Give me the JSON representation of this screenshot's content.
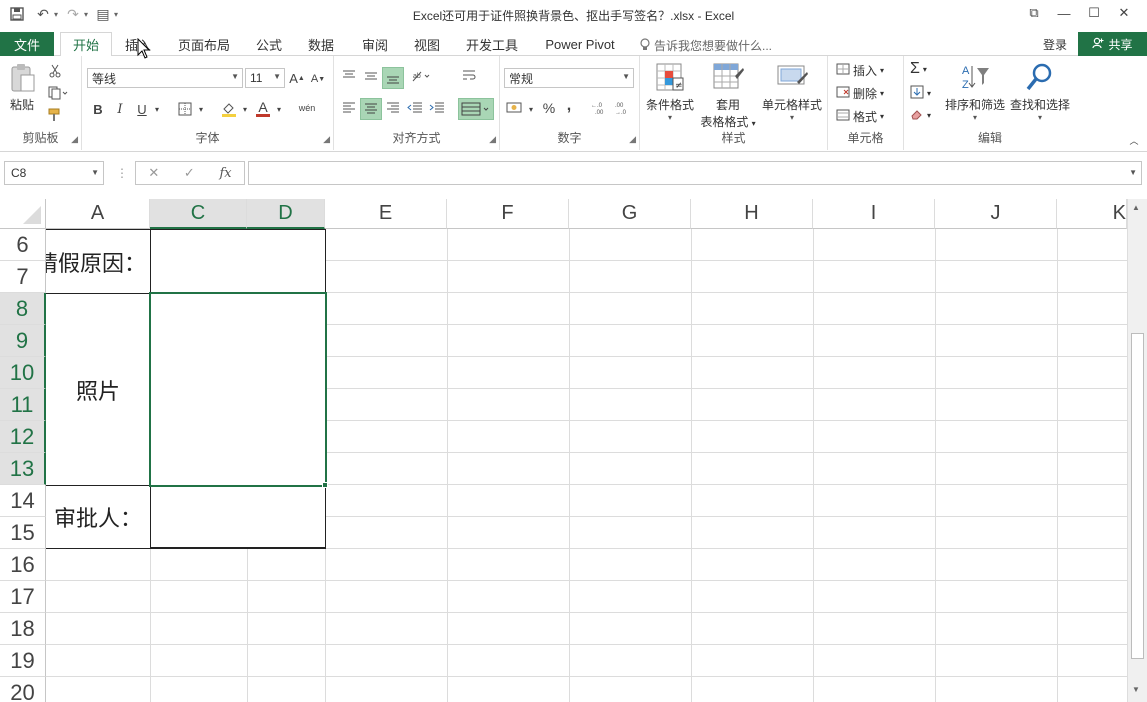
{
  "titlebar": {
    "title": "Excel还可用于证件照换背景色、抠出手写签名？.xlsx - Excel",
    "qat": {
      "save": "💾",
      "undo": "↶",
      "redo": "↷",
      "form": "▤",
      "more": "▾"
    },
    "controls": {
      "ribbon_options": "⧉",
      "minimize": "—",
      "maximize": "☐",
      "close": "✕"
    }
  },
  "tabs": {
    "file": "文件",
    "items": [
      "开始",
      "插入",
      "页面布局",
      "公式",
      "数据",
      "审阅",
      "视图",
      "开发工具",
      "Power Pivot"
    ],
    "active": "开始",
    "tellme": "告诉我您想要做什么...",
    "login": "登录",
    "share": "共享"
  },
  "ribbon": {
    "clipboard": {
      "label": "剪贴板",
      "paste": "粘贴"
    },
    "font": {
      "label": "字体",
      "font_name": "等线",
      "font_size": "11",
      "bold": "B",
      "italic": "I",
      "underline": "U",
      "grow": "A",
      "shrink": "A",
      "font_color": "A",
      "wen": "wén"
    },
    "alignment": {
      "label": "对齐方式"
    },
    "number": {
      "label": "数字",
      "format": "常规",
      "percent": "%",
      "comma": ",",
      "inc": ".0→.00",
      "dec": ".00→.0"
    },
    "styles": {
      "label": "样式",
      "cond": "条件格式",
      "table1": "套用",
      "table2": "表格格式",
      "cell": "单元格样式"
    },
    "cells": {
      "label": "单元格",
      "insert": "插入",
      "delete": "删除",
      "format": "格式"
    },
    "editing": {
      "label": "编辑",
      "sort": "排序和筛选",
      "find": "查找和选择",
      "sigma": "Σ"
    }
  },
  "formula_bar": {
    "name_box": "C8",
    "cancel": "✕",
    "enter": "✓",
    "fx": "fx",
    "value": ""
  },
  "sheet": {
    "columns": [
      "A",
      "C",
      "D",
      "E",
      "F",
      "G",
      "H",
      "I",
      "J",
      "K"
    ],
    "rows": [
      "6",
      "7",
      "8",
      "9",
      "10",
      "11",
      "12",
      "13",
      "14",
      "15",
      "16",
      "17",
      "18",
      "19",
      "20"
    ],
    "selected_columns": [
      "C",
      "D"
    ],
    "selected_rows": [
      "8",
      "9",
      "10",
      "11",
      "12",
      "13"
    ],
    "merged": {
      "reason_label": "请假原因：",
      "photo_label": "照片",
      "approver_label": "审批人："
    }
  }
}
